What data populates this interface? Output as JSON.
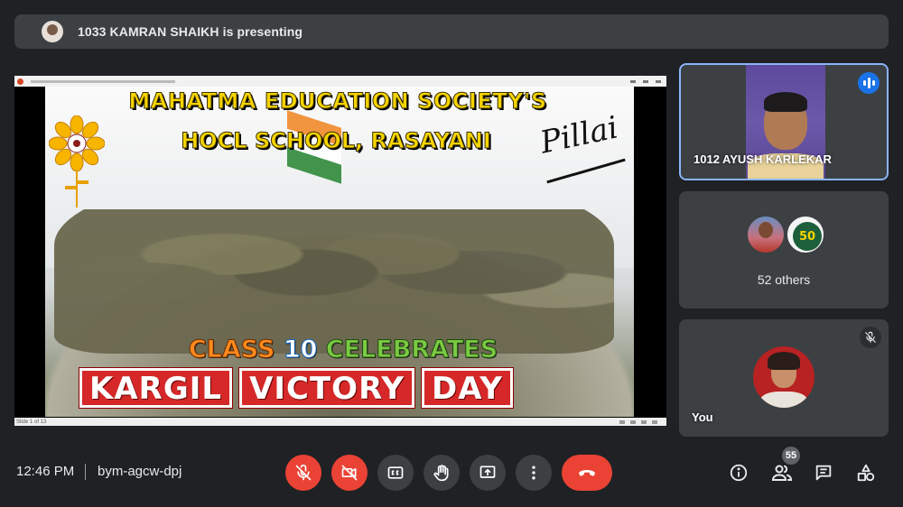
{
  "presenter_banner": {
    "text": "1033 KAMRAN SHAIKH is presenting"
  },
  "slide": {
    "title_line1": "MAHATMA EDUCATION SOCIETY'S",
    "title_line2": "HOCL SCHOOL, RASAYANI",
    "signature": "Pillai",
    "class_prefix": "CLASS ",
    "class_number": "10",
    "class_suffix": " CELEBRATES",
    "banner_words": [
      "KARGIL",
      "VICTORY",
      "DAY"
    ],
    "status_text": "Slide 1 of 13"
  },
  "participants": [
    {
      "name": "1012 AYUSH KARLEKAR",
      "speaking": true
    },
    {
      "name": "52 others"
    },
    {
      "name": "You",
      "muted": true
    }
  ],
  "others_badge_text": "50",
  "bottom_bar": {
    "time": "12:46 PM",
    "meeting_code": "bym-agcw-dpj",
    "participant_count": "55"
  },
  "colors": {
    "background": "#202124",
    "tile": "#3c4043",
    "active_border": "#8ab4f8",
    "danger": "#ea4335",
    "accent": "#1a73e8"
  },
  "icons": [
    "mic-off-icon",
    "camera-off-icon",
    "captions-icon",
    "raise-hand-icon",
    "present-icon",
    "more-options-icon",
    "end-call-icon",
    "info-icon",
    "people-icon",
    "chat-icon",
    "activities-icon"
  ]
}
